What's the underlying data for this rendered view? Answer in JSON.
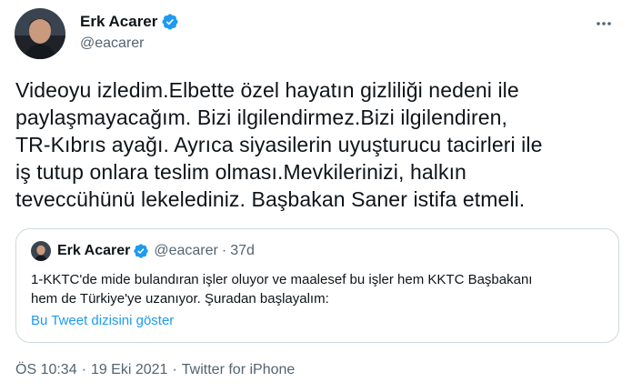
{
  "author": {
    "name": "Erk Acarer",
    "handle": "@eacarer"
  },
  "tweet": {
    "text": "Videoyu izledim.Elbette özel hayatın gizliliği nedeni ile\npaylaşmayacağım. Bizi ilgilendirmez.Bizi ilgilendiren,\nTR-Kıbrıs ayağı. Ayrıca siyasilerin uyuşturucu tacirleri ile\niş tutup onlara teslim olması.Mevkilerinizi, halkın\nteveccühünü lekelediniz. Başbakan Saner istifa etmeli."
  },
  "quoted_tweet": {
    "name": "Erk Acarer",
    "handle": "@eacarer",
    "separator": "·",
    "time": "37d",
    "text": "1-KKTC'de mide bulandıran işler oluyor ve maalesef bu işler hem KKTC Başbakanı\nhem de Türkiye'ye uzanıyor. Şuradan başlayalım:",
    "thread_link": "Bu Tweet dizisini göster"
  },
  "meta": {
    "time": "ÖS 10:34",
    "separator": "·",
    "date": "19 Eki 2021",
    "source": "Twitter for iPhone"
  },
  "colors": {
    "accent": "#1d9bf0",
    "secondary_text": "#536471",
    "border": "#cfd9de"
  },
  "icons": {
    "verified": "verified-badge-icon",
    "more": "more-dots-icon"
  }
}
